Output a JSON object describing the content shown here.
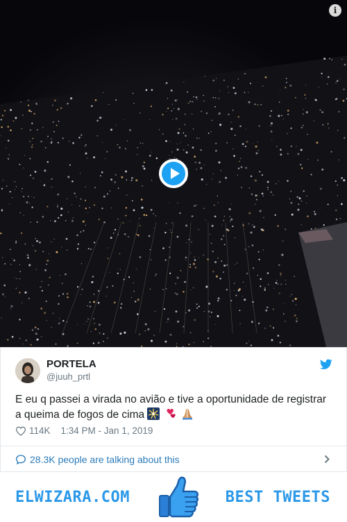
{
  "video": {
    "info_icon": "info-icon",
    "play_icon": "play-icon"
  },
  "tweet": {
    "author_name": "PORTELA",
    "author_handle": "@juuh_prtl",
    "text": "E eu q passei a virada no avião e tive a oportunidade de registrar a queima de fogos de cima",
    "emojis": [
      "fireworks-emoji",
      "two-hearts-emoji",
      "folded-hands-emoji"
    ],
    "likes": "114K",
    "timestamp": "1:34 PM - Jan 1, 2019",
    "talking": "28.3K people are talking about this",
    "brand_color": "#1da1f2",
    "link_color": "#2b7bb9"
  },
  "banner": {
    "site": "ELWIZARA.COM",
    "label": "BEST TWEETS",
    "icon": "thumbs-up-icon",
    "color": "#2b98e8"
  }
}
